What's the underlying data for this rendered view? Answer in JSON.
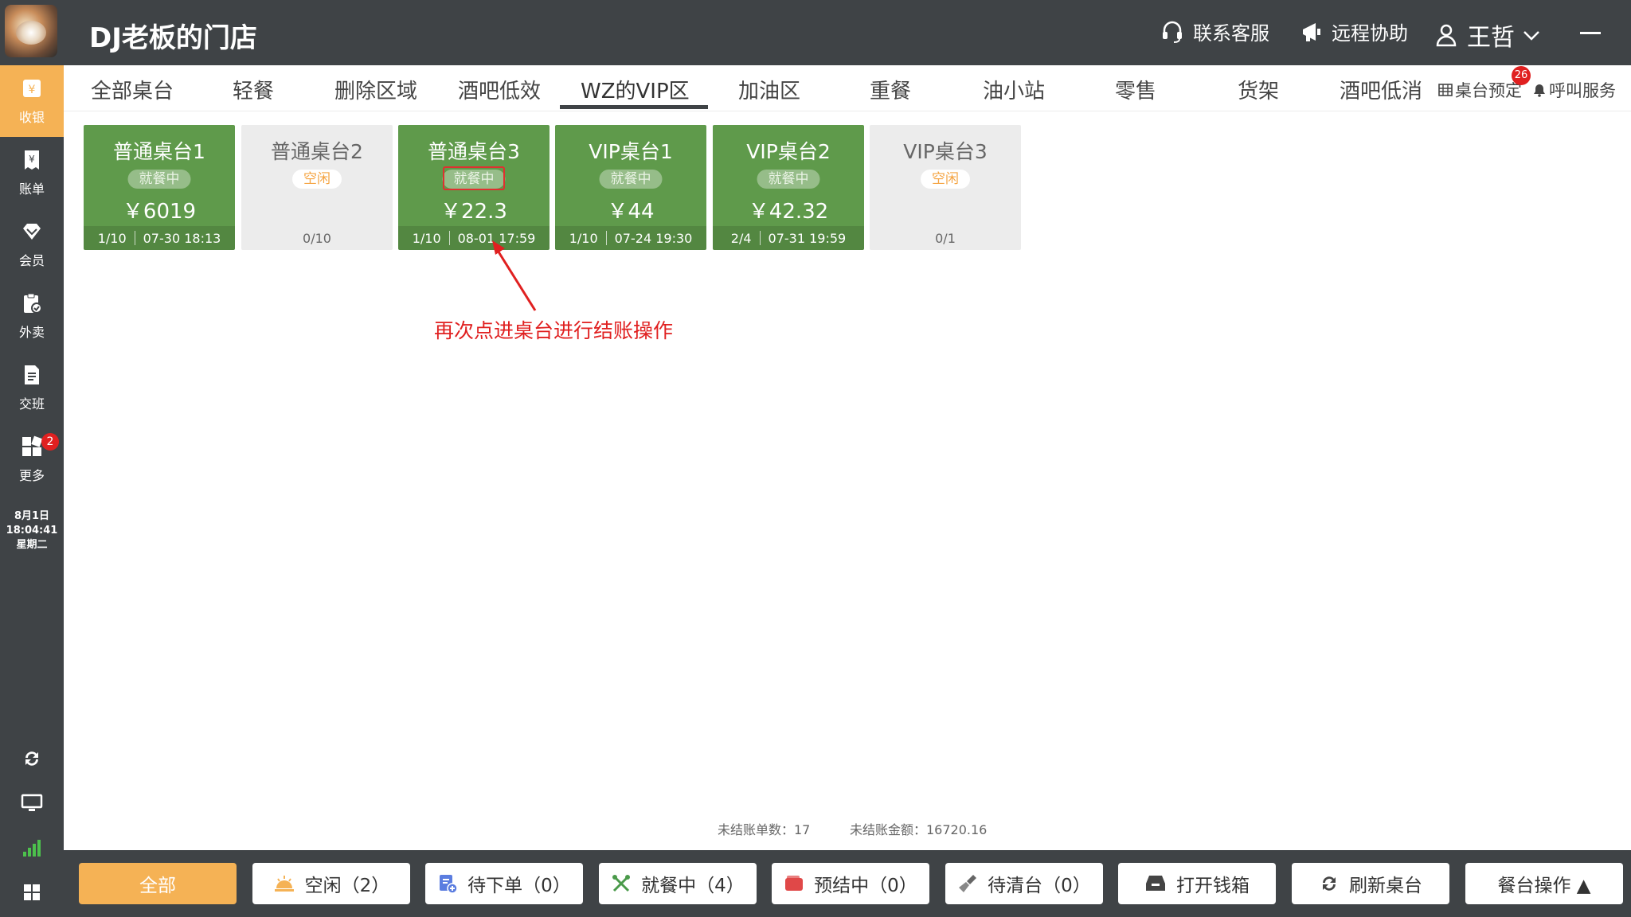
{
  "header": {
    "store_name": "DJ老板的门店",
    "support_label": "联系客服",
    "remote_label": "远程协助",
    "user_name": "王哲"
  },
  "sidebar": {
    "items": [
      {
        "label": "收银",
        "icon": "cashier-icon",
        "active": true
      },
      {
        "label": "账单",
        "icon": "bill-icon"
      },
      {
        "label": "会员",
        "icon": "member-icon"
      },
      {
        "label": "外卖",
        "icon": "takeout-icon"
      },
      {
        "label": "交班",
        "icon": "shift-icon"
      },
      {
        "label": "更多",
        "icon": "more-grid-icon",
        "badge": "2"
      }
    ],
    "clock": {
      "date": "8月1日",
      "time": "18:04:41",
      "weekday": "星期二"
    }
  },
  "tabs": {
    "items": [
      "全部桌台",
      "轻餐",
      "删除区域",
      "酒吧低效",
      "WZ的VIP区",
      "加油区",
      "重餐",
      "油小站",
      "零售",
      "货架",
      "酒吧低消"
    ],
    "active_index": 4,
    "reservation_label": "桌台预定",
    "reservation_badge": "26",
    "call_service_label": "呼叫服务"
  },
  "tables": [
    {
      "name": "普通桌台1",
      "status": "就餐中",
      "amount": "￥6019",
      "guests": "1/10",
      "time": "07-30 18:13",
      "state": "busy"
    },
    {
      "name": "普通桌台2",
      "status": "空闲",
      "amount": "",
      "guests": "0/10",
      "time": "",
      "state": "idle"
    },
    {
      "name": "普通桌台3",
      "status": "就餐中",
      "amount": "￥22.3",
      "guests": "1/10",
      "time": "08-01 17:59",
      "state": "busy"
    },
    {
      "name": "VIP桌台1",
      "status": "就餐中",
      "amount": "￥44",
      "guests": "1/10",
      "time": "07-24 19:30",
      "state": "busy"
    },
    {
      "name": "VIP桌台2",
      "status": "就餐中",
      "amount": "￥42.32",
      "guests": "2/4",
      "time": "07-31 19:59",
      "state": "busy"
    },
    {
      "name": "VIP桌台3",
      "status": "空闲",
      "amount": "",
      "guests": "0/1",
      "time": "",
      "state": "idle"
    }
  ],
  "annotation": "再次点进桌台进行结账操作",
  "summary": {
    "unpaid_count_label": "未结账单数：17",
    "unpaid_amount_label": "未结账金额：16720.16"
  },
  "bottom_bar": {
    "all": "全部",
    "idle": "空闲（2）",
    "pending_order": "待下单（0）",
    "dining": "就餐中（4）",
    "pre_checkout": "预结中（0）",
    "to_clean": "待清台（0）",
    "open_drawer": "打开钱箱",
    "refresh": "刷新桌台",
    "table_ops": "餐台操作 ▲"
  },
  "colors": {
    "dark": "#3f4346",
    "accent": "#f5b255",
    "busy_green": "#5f9a4b",
    "idle_gray": "#ececec",
    "alert_red": "#e02020"
  }
}
